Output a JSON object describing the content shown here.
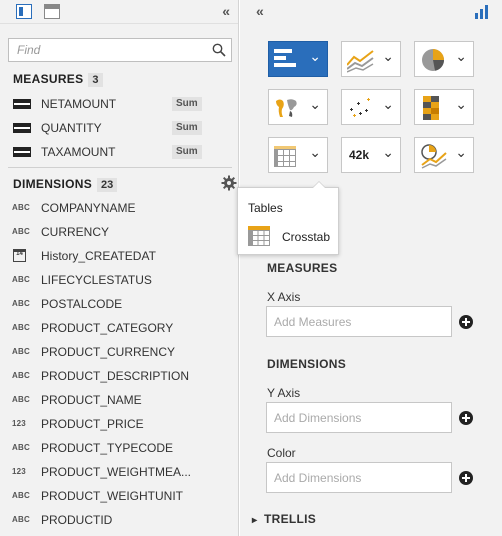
{
  "left": {
    "search": {
      "placeholder": "Find"
    },
    "measures": {
      "title": "MEASURES",
      "count": "3",
      "items": [
        {
          "label": "NETAMOUNT",
          "agg": "Sum"
        },
        {
          "label": "QUANTITY",
          "agg": "Sum"
        },
        {
          "label": "TAXAMOUNT",
          "agg": "Sum"
        }
      ]
    },
    "dimensions": {
      "title": "DIMENSIONS",
      "count": "23",
      "items": [
        {
          "type": "ABC",
          "label": "COMPANYNAME"
        },
        {
          "type": "ABC",
          "label": "CURRENCY"
        },
        {
          "type": "14",
          "label": "History_CREATEDAT"
        },
        {
          "type": "ABC",
          "label": "LIFECYCLESTATUS"
        },
        {
          "type": "ABC",
          "label": "POSTALCODE"
        },
        {
          "type": "ABC",
          "label": "PRODUCT_CATEGORY"
        },
        {
          "type": "ABC",
          "label": "PRODUCT_CURRENCY"
        },
        {
          "type": "ABC",
          "label": "PRODUCT_DESCRIPTION"
        },
        {
          "type": "ABC",
          "label": "PRODUCT_NAME"
        },
        {
          "type": "123",
          "label": "PRODUCT_PRICE"
        },
        {
          "type": "ABC",
          "label": "PRODUCT_TYPECODE"
        },
        {
          "type": "123",
          "label": "PRODUCT_WEIGHTMEA..."
        },
        {
          "type": "ABC",
          "label": "PRODUCT_WEIGHTUNIT"
        },
        {
          "type": "ABC",
          "label": "PRODUCTID"
        }
      ]
    }
  },
  "right": {
    "chart_types": [
      {
        "icon": "bar-chart-icon",
        "active": true
      },
      {
        "icon": "line-chart-icon",
        "active": false
      },
      {
        "icon": "pie-chart-icon",
        "active": false
      },
      {
        "icon": "geo-map-icon",
        "active": false
      },
      {
        "icon": "scatter-chart-icon",
        "active": false
      },
      {
        "icon": "heatmap-icon",
        "active": false
      },
      {
        "icon": "table-icon",
        "active": false
      },
      {
        "icon": "numeric-point-icon",
        "active": false,
        "text": "42k"
      },
      {
        "icon": "other-chart-icon",
        "active": false
      }
    ],
    "popover": {
      "title": "Tables",
      "item": "Crosstab"
    },
    "measures_title": "MEASURES",
    "x_axis": {
      "label": "X Axis",
      "placeholder": "Add Measures"
    },
    "dimensions_title": "DIMENSIONS",
    "y_axis": {
      "label": "Y Axis",
      "placeholder": "Add Dimensions"
    },
    "color": {
      "label": "Color",
      "placeholder": "Add Dimensions"
    },
    "trellis": "TRELLIS"
  },
  "colors": {
    "accent": "#2a6ebb",
    "gold": "#e8a317",
    "panel": "#f2f2f2"
  }
}
